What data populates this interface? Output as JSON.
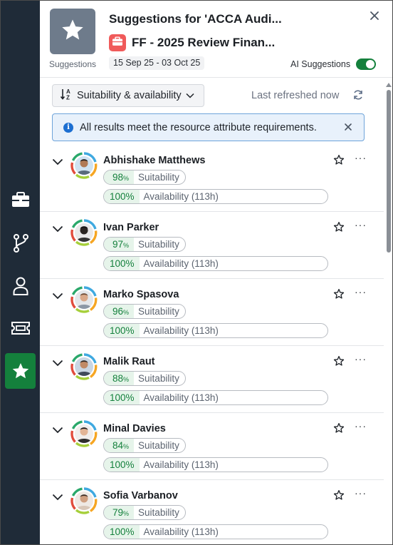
{
  "header": {
    "icon_label": "Suggestions",
    "title": "Suggestions for 'ACCA Audi...",
    "project_title": "FF - 2025 Review Finan...",
    "date_range": "15 Sep 25 - 03 Oct 25",
    "ai_label": "AI Suggestions",
    "ai_enabled": true
  },
  "toolbar": {
    "sort_label": "Suitability & availability",
    "refreshed_label": "Last refreshed now"
  },
  "alert": {
    "message": "All results meet the resource attribute requirements."
  },
  "labels": {
    "suitability": "Suitability",
    "availability": "Availability (113h)"
  },
  "candidates": [
    {
      "name": "Abhishake Matthews",
      "suitability": "98",
      "availability": "100%"
    },
    {
      "name": "Ivan Parker",
      "suitability": "97",
      "availability": "100%"
    },
    {
      "name": "Marko Spasova",
      "suitability": "96",
      "availability": "100%"
    },
    {
      "name": "Malik Raut",
      "suitability": "88",
      "availability": "100%"
    },
    {
      "name": "Minal Davies",
      "suitability": "84",
      "availability": "100%"
    },
    {
      "name": "Sofia Varbanov",
      "suitability": "79",
      "availability": "100%"
    }
  ],
  "colors": {
    "rail": "#1f2b38",
    "accent_green": "#14803c",
    "alert_bg": "#e8f1fb",
    "alert_border": "#6ea4da",
    "project_badge": "#f05a5a"
  }
}
